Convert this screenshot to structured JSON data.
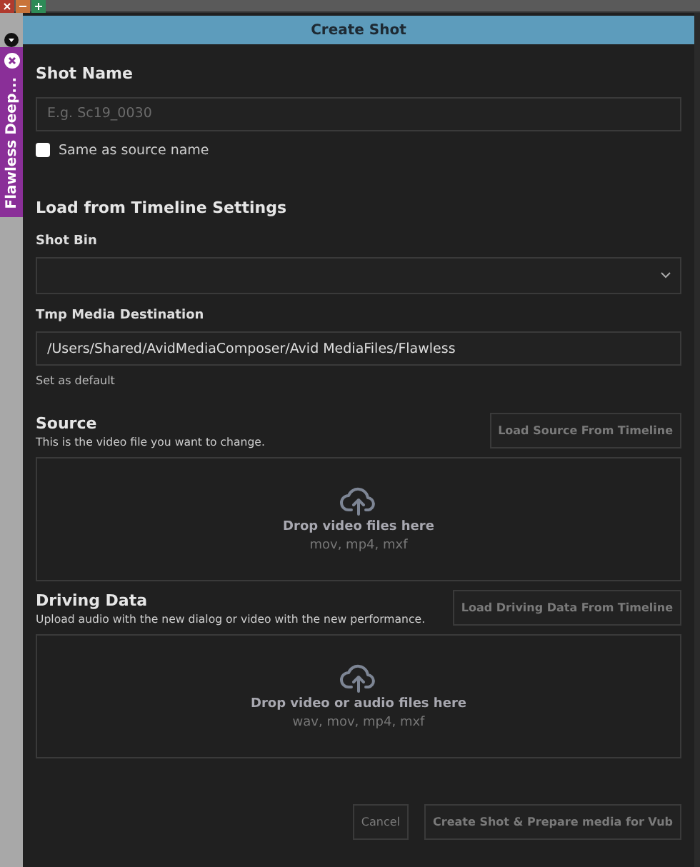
{
  "side_tab": {
    "label": "Flawless Deep..."
  },
  "dialog": {
    "title": "Create Shot"
  },
  "shot_name": {
    "label": "Shot Name",
    "placeholder": "E.g. Sc19_0030",
    "same_as_source": {
      "label": "Same as source name",
      "checked": false
    }
  },
  "timeline_settings": {
    "title": "Load from Timeline Settings",
    "shot_bin": {
      "label": "Shot Bin"
    },
    "tmp_media": {
      "label": "Tmp Media Destination",
      "value": "/Users/Shared/AvidMediaComposer/Avid MediaFiles/Flawless",
      "link": "Set as default"
    }
  },
  "sections": [
    {
      "title": "Source",
      "description": "This is the video file you want to change.",
      "button": {
        "label": "Load Source From Timeline",
        "disabled": true
      },
      "drop": {
        "label": "Drop video files here",
        "formats": "mov, mp4, mxf"
      }
    },
    {
      "title": "Driving Data",
      "description": "Upload audio with the new dialog or video with the new performance.",
      "button": {
        "label": "Load Driving Data From Timeline",
        "disabled": true
      },
      "drop": {
        "label": "Drop video or audio files here",
        "formats": "wav, mov, mp4, mxf"
      }
    }
  ],
  "footer": {
    "buttons": [
      {
        "label": "Cancel",
        "disabled": true
      },
      {
        "label": "Create Shot & Prepare media for Vub",
        "disabled": true
      }
    ]
  }
}
